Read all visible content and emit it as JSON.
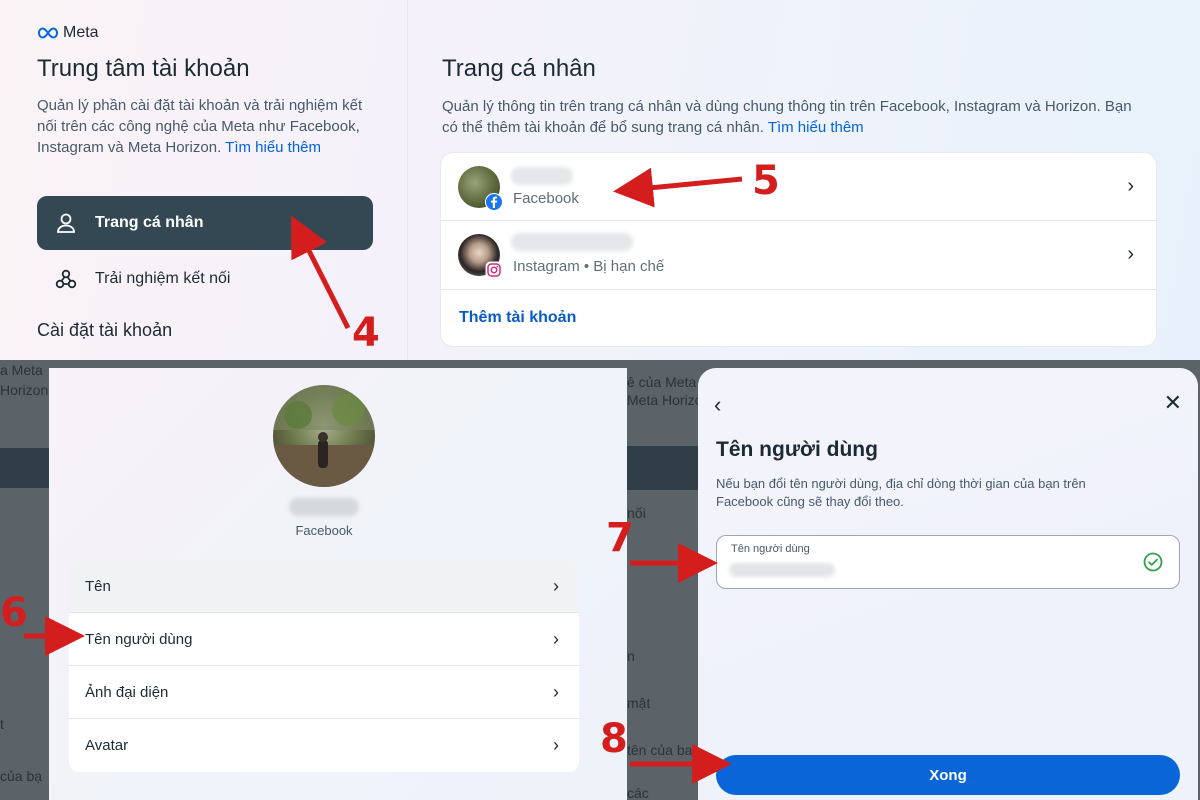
{
  "top_left": {
    "brand": "Meta",
    "title": "Trung tâm tài khoản",
    "description": "Quản lý phần cài đặt tài khoản và trải nghiệm kết nối trên các công nghệ của Meta như Facebook, Instagram và Meta Horizon.",
    "learn_more": "Tìm hiểu thêm",
    "nav": [
      {
        "label": "Trang cá nhân",
        "icon": "person-icon",
        "active": true
      },
      {
        "label": "Trải nghiệm kết nối",
        "icon": "connected-icon",
        "active": false
      }
    ],
    "section_heading": "Cài đặt tài khoản"
  },
  "top_right": {
    "title": "Trang cá nhân",
    "description": "Quản lý thông tin trên trang cá nhân và dùng chung thông tin trên Facebook, Instagram và Horizon. Bạn có thể thêm tài khoản để bổ sung trang cá nhân.",
    "learn_more": "Tìm hiểu thêm",
    "accounts": [
      {
        "platform": "Facebook",
        "badge": "facebook-icon"
      },
      {
        "platform": "Instagram • Bị hạn chế",
        "badge": "instagram-icon"
      }
    ],
    "add_account": "Thêm tài khoản"
  },
  "profile_panel": {
    "platform": "Facebook",
    "menu": [
      "Tên",
      "Tên người dùng",
      "Ảnh đại diện",
      "Avatar"
    ]
  },
  "modal": {
    "title": "Tên người dùng",
    "description": "Nếu bạn đổi tên người dùng, địa chỉ dòng thời gian của bạn trên Facebook cũng sẽ thay đổi theo.",
    "field_label": "Tên người dùng",
    "done": "Xong"
  },
  "background_text": {
    "left": [
      "a Meta",
      "Horizon",
      "t",
      "của bạ"
    ],
    "right": [
      "ê của Meta",
      "Meta Horizo",
      "nối",
      "n",
      "mật",
      "tên của ba",
      "các"
    ]
  },
  "annotations": [
    "4",
    "5",
    "6",
    "7",
    "8"
  ],
  "colors": {
    "accent": "#0064e0",
    "nav_active": "#344854",
    "arrow": "#d41e1e",
    "button": "#0a66d8"
  }
}
